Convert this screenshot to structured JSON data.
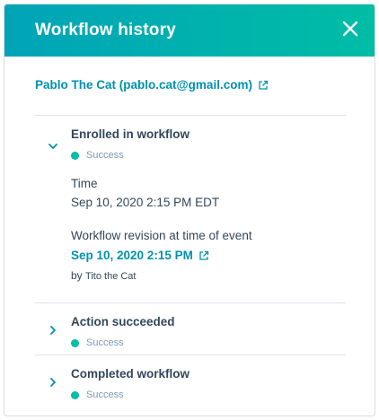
{
  "header": {
    "title": "Workflow history",
    "close_icon": "close-icon"
  },
  "contact": {
    "label": "Pablo The Cat (pablo.cat@gmail.com)",
    "icon": "external-link-icon"
  },
  "events": [
    {
      "title": "Enrolled in workflow",
      "status": "Success",
      "expanded": true,
      "time_label": "Time",
      "time_value": "Sep 10, 2020 2:15 PM EDT",
      "revision_label": "Workflow revision at time of event",
      "revision_link": "Sep 10, 2020 2:15 PM",
      "by_prefix": "by",
      "by_name": "Tito the Cat"
    },
    {
      "title": "Action succeeded",
      "status": "Success",
      "expanded": false
    },
    {
      "title": "Completed workflow",
      "status": "Success",
      "expanded": false
    }
  ],
  "colors": {
    "header_start": "#00a4b8",
    "header_end": "#00bda5",
    "link": "#0091ae",
    "success": "#00bda5",
    "text": "#33475b",
    "muted": "#7c98b6"
  }
}
